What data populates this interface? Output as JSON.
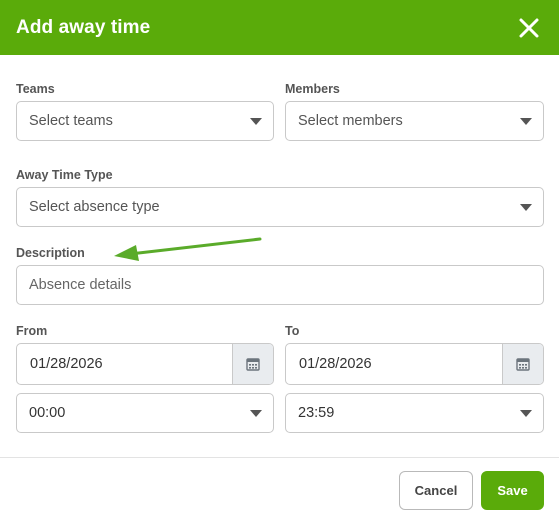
{
  "dialog": {
    "title": "Add away time",
    "accent_color": "#5aab0a"
  },
  "form": {
    "teams": {
      "label": "Teams",
      "value": "Select teams"
    },
    "members": {
      "label": "Members",
      "value": "Select members"
    },
    "away_type": {
      "label": "Away Time Type",
      "value": "Select absence type"
    },
    "description": {
      "label": "Description",
      "placeholder": "Absence details"
    },
    "from": {
      "label": "From",
      "date": "01/28/2026",
      "time": "00:00"
    },
    "to": {
      "label": "To",
      "date": "01/28/2026",
      "time": "23:59"
    }
  },
  "footer": {
    "cancel_label": "Cancel",
    "save_label": "Save"
  },
  "icons": {
    "close": "close-icon",
    "calendar": "calendar-icon",
    "caret": "chevron-down-icon",
    "annotation": "arrow-annotation"
  },
  "annotation_color": "#5aab2a"
}
